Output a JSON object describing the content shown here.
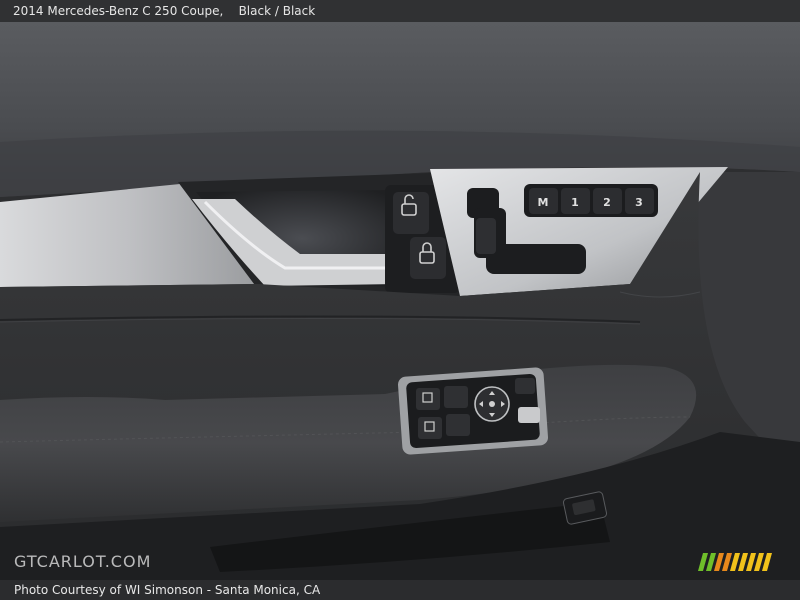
{
  "header": {
    "title": "2014 Mercedes-Benz C 250 Coupe,",
    "color_label": "Black / Black"
  },
  "footer": {
    "credit": "Photo Courtesy of WI Simonson - Santa Monica, CA"
  },
  "watermark": {
    "text": "GTCARLOT.COM"
  },
  "seat_memory_buttons": [
    "M",
    "1",
    "2",
    "3"
  ],
  "icons": [
    "door-unlock-icon",
    "door-lock-icon",
    "seat-adjust-icon",
    "mirror-control-icon",
    "window-switch-icon",
    "stripes-logo-icon"
  ],
  "colors": {
    "leather": "#3b3c3e",
    "trim": "#c8c9cb",
    "logo_green": "#6fbf2a",
    "logo_orange": "#e7881c",
    "logo_yellow": "#f1c21b"
  }
}
